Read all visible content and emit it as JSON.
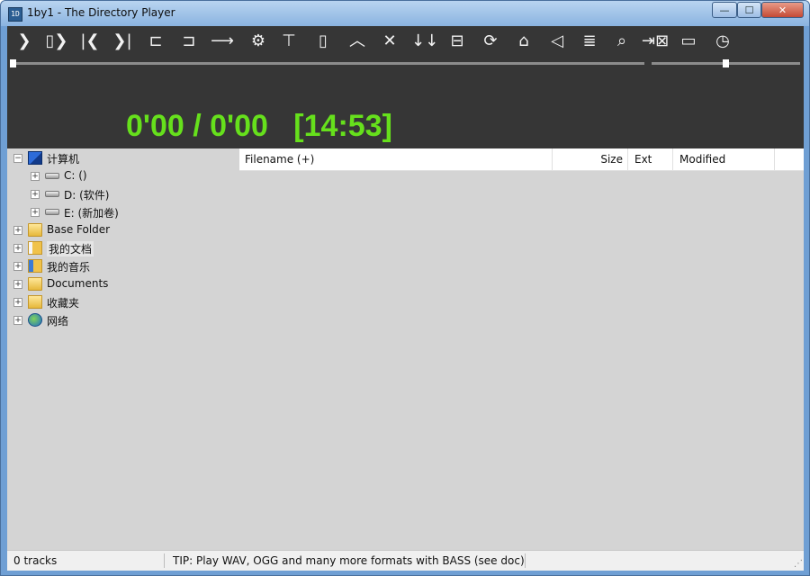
{
  "window": {
    "title": "1by1 - The Directory Player",
    "app_icon": "1D"
  },
  "window_controls": {
    "minimize": "—",
    "maximize": "☐",
    "close": "✕"
  },
  "toolbar": {
    "buttons": [
      {
        "name": "play-icon",
        "glyph": "❯"
      },
      {
        "name": "pause-play-icon",
        "glyph": "▯❯"
      },
      {
        "name": "previous-track-icon",
        "glyph": "|❮"
      },
      {
        "name": "next-track-icon",
        "glyph": "❯|"
      },
      {
        "name": "folder-back-icon",
        "glyph": "⊏"
      },
      {
        "name": "folder-forward-icon",
        "glyph": "⊐"
      },
      {
        "name": "jump-arrow-icon",
        "glyph": "⟶"
      },
      {
        "name": "settings-gear-icon",
        "glyph": "⚙"
      },
      {
        "name": "window-layout-icon",
        "glyph": "⊤"
      },
      {
        "name": "sidebar-toggle-icon",
        "glyph": "▯"
      },
      {
        "name": "collapse-up-icon",
        "glyph": "︿"
      },
      {
        "name": "close-x-icon",
        "glyph": "✕"
      },
      {
        "name": "sort-down-icon",
        "glyph": "↓↓"
      },
      {
        "name": "split-view-icon",
        "glyph": "⊟"
      },
      {
        "name": "repeat-icon",
        "glyph": "⟳"
      },
      {
        "name": "home-icon",
        "glyph": "⌂"
      },
      {
        "name": "speaker-icon",
        "glyph": "◁"
      },
      {
        "name": "playlist-cursor-icon",
        "glyph": "≣"
      },
      {
        "name": "search-zoom-icon",
        "glyph": "⌕"
      },
      {
        "name": "remove-item-icon",
        "glyph": "⇥⊠"
      },
      {
        "name": "info-panel-icon",
        "glyph": "▭"
      },
      {
        "name": "timer-clock-icon",
        "glyph": "◷"
      }
    ]
  },
  "seek": {
    "position_fraction": 0.0
  },
  "volume": {
    "level_fraction": 0.5
  },
  "time": {
    "display": "0'00 / 0'00   [14:53]"
  },
  "tree": {
    "nodes": [
      {
        "label": "计算机",
        "expander": "−",
        "level": 0,
        "icon": "computer-icon"
      },
      {
        "label": "C: ()",
        "expander": "+",
        "level": 1,
        "icon": "drive-icon"
      },
      {
        "label": "D: (软件)",
        "expander": "+",
        "level": 1,
        "icon": "drive-icon"
      },
      {
        "label": "E: (新加卷)",
        "expander": "+",
        "level": 1,
        "icon": "drive-icon"
      },
      {
        "label": "Base Folder",
        "expander": "+",
        "level": 0,
        "icon": "folder-icon"
      },
      {
        "label": "我的文档",
        "expander": "+",
        "level": 0,
        "icon": "documents-folder-icon",
        "selected": true
      },
      {
        "label": "我的音乐",
        "expander": "+",
        "level": 0,
        "icon": "music-folder-icon"
      },
      {
        "label": "Documents",
        "expander": "+",
        "level": 0,
        "icon": "folder-icon"
      },
      {
        "label": "收藏夹",
        "expander": "+",
        "level": 0,
        "icon": "favorites-folder-icon"
      },
      {
        "label": "网络",
        "expander": "+",
        "level": 0,
        "icon": "network-icon"
      }
    ]
  },
  "file_list": {
    "columns": [
      {
        "label": "Filename (+)",
        "align": "left"
      },
      {
        "label": "Size",
        "align": "right"
      },
      {
        "label": "Ext",
        "align": "left"
      },
      {
        "label": "Modified",
        "align": "left"
      }
    ]
  },
  "status": {
    "tracks": "0 tracks",
    "tip": "TIP: Play WAV, OGG and many more formats with BASS (see doc)"
  },
  "colors": {
    "toolbar_bg": "#363636",
    "time_text": "#66e01c",
    "client_bg": "#d4d4d4"
  }
}
